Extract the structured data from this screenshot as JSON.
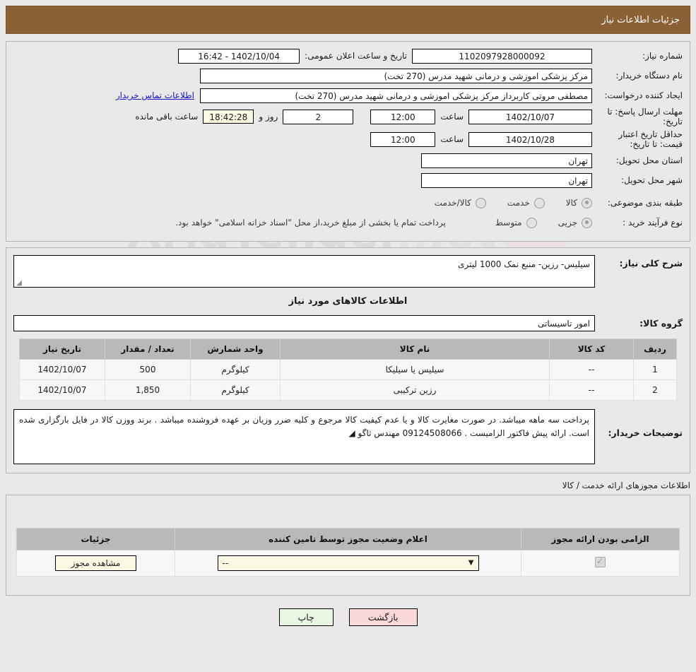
{
  "header": {
    "title": "جزئیات اطلاعات نیاز"
  },
  "watermark": {
    "text_main": "AriaTender",
    "text_dim": ".net"
  },
  "form": {
    "need_number_label": "شماره نیاز:",
    "need_number_value": "1102097928000092",
    "public_announce_label": "تاریخ و ساعت اعلان عمومی:",
    "public_announce_value": "1402/10/04 - 16:42",
    "buyer_org_label": "نام دستگاه خریدار:",
    "buyer_org_value": "مرکز پزشکی  اموزشی و درمانی شهید مدرس (270 تخت)",
    "creator_label": "ایجاد کننده درخواست:",
    "creator_value": "مصطفی مروتی کاربرداز مرکز پزشکی  اموزشی و درمانی شهید مدرس (270 تخت)",
    "buyer_contact_link": "اطلاعات تماس خریدار",
    "reply_deadline_label": "مهلت ارسال پاسخ: تا تاریخ:",
    "reply_deadline_date": "1402/10/07",
    "hour_label": "ساعت",
    "reply_deadline_time": "12:00",
    "remaining_days": "2",
    "days_and_label": "روز و",
    "remaining_clock": "18:42:28",
    "remaining_suffix": "ساعت باقی مانده",
    "price_validity_label": "حداقل تاریخ اعتبار قیمت: تا تاریخ:",
    "price_validity_date": "1402/10/28",
    "price_validity_time": "12:00",
    "province_label": "استان محل تحویل:",
    "province_value": "تهران",
    "city_label": "شهر محل تحویل:",
    "city_value": "تهران",
    "category_label": "طبقه بندی موضوعی:",
    "category_options": [
      "کالا",
      "خدمت",
      "کالا/خدمت"
    ],
    "process_label": "نوع فرآیند خرید :",
    "process_options": [
      "جزیی",
      "متوسط"
    ],
    "process_note": "پرداخت تمام یا بخشی از مبلغ خرید،از محل \"اسناد خزانه اسلامی\" خواهد بود."
  },
  "description": {
    "label": "شرح کلی نیاز:",
    "value": "سیلیس- رزین- منبع نمک 1000 لیتری"
  },
  "goods_section": {
    "title": "اطلاعات کالاهای مورد نیاز",
    "group_label": "گروه کالا:",
    "group_value": "امور تاسیساتی",
    "columns": [
      "ردیف",
      "کد کالا",
      "نام کالا",
      "واحد شمارش",
      "تعداد / مقدار",
      "تاریخ نیاز"
    ],
    "rows": [
      {
        "index": "1",
        "code": "--",
        "name": "سیلیس یا سیلیکا",
        "unit": "کیلوگرم",
        "qty": "500",
        "date": "1402/10/07"
      },
      {
        "index": "2",
        "code": "--",
        "name": "رزین ترکیبی",
        "unit": "کیلوگرم",
        "qty": "1,850",
        "date": "1402/10/07"
      }
    ]
  },
  "notes": {
    "label": "توضیحات خریدار:",
    "value": "پرداخت سه ماهه میباشد. در صورت مغایرت کالا و یا عدم کیفیت کالا مرجوع و کلیه ضرر وزیان بر عهده فروشنده میباشد . برند ووزن کالا در فایل بارگزاری شده است. ارائه پیش فاکتور الزامیست . 09124508066 مهندس ثاگو"
  },
  "licenses": {
    "section_title": "اطلاعات مجوزهای ارائه خدمت / کالا",
    "columns": [
      "الزامی بودن ارائه مجوز",
      "اعلام وضعیت مجوز توسط تامین کننده",
      "جزئیات"
    ],
    "rows": [
      {
        "required": true,
        "status": "--",
        "details_button": "مشاهده مجوز"
      }
    ]
  },
  "footer": {
    "back_button": "بازگشت",
    "print_button": "چاپ"
  },
  "colors": {
    "titlebar": "#8a6135",
    "link": "#1414d2",
    "back_button": "#fbd8d8",
    "print_button": "#e8f6e4",
    "highlight": "#fbf8e3"
  }
}
